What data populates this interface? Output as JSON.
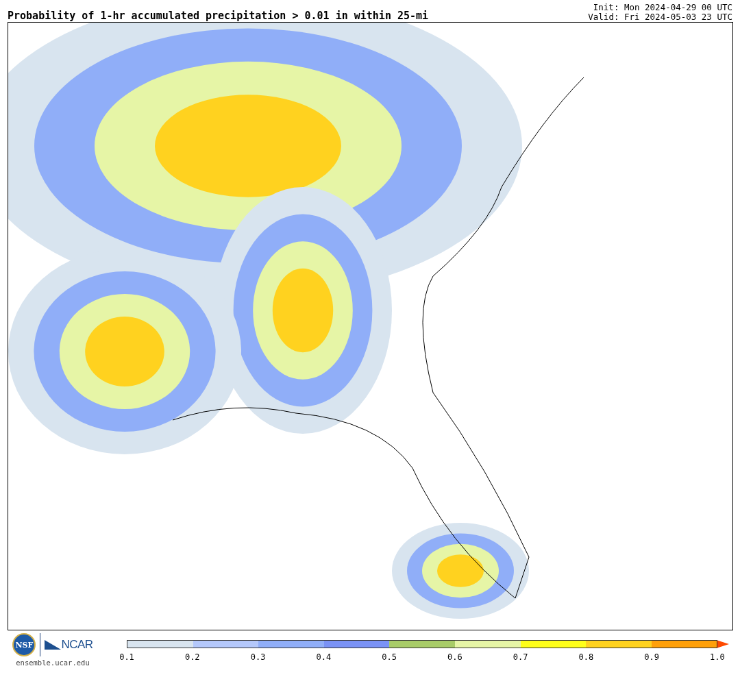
{
  "title": "Probability of 1-hr accumulated precipitation > 0.01 in within 25-mi",
  "init": "Init: Mon 2024-04-29 00 UTC",
  "valid": "Valid: Fri 2024-05-03 23 UTC",
  "logos": {
    "nsf": "NSF",
    "ncar": "NCAR",
    "site": "ensemble.ucar.edu"
  },
  "legend": {
    "bins": [
      {
        "color": "#d8e4ef"
      },
      {
        "color": "#b4c8fb"
      },
      {
        "color": "#90aef8"
      },
      {
        "color": "#7a92f5"
      },
      {
        "color": "#a8cc68"
      },
      {
        "color": "#e6f5a6"
      },
      {
        "color": "#ffff1a"
      },
      {
        "color": "#ffd21f"
      },
      {
        "color": "#ffa00a"
      }
    ],
    "overflow": {
      "color": "#ff4a00"
    },
    "ticks": [
      "0.1",
      "0.2",
      "0.3",
      "0.4",
      "0.5",
      "0.6",
      "0.7",
      "0.8",
      "0.9",
      "1.0"
    ]
  }
}
